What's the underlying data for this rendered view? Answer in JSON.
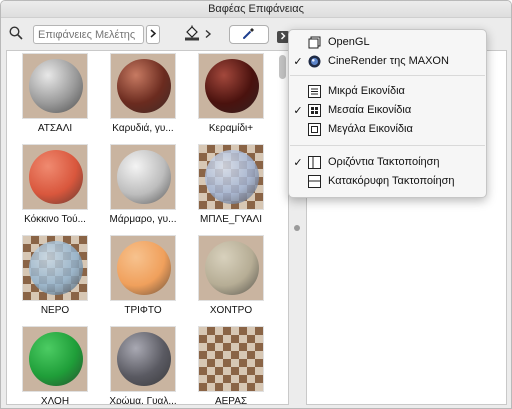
{
  "window": {
    "title": "Βαφέας Επιφάνειας"
  },
  "toolbar": {
    "search_placeholder": "Επιφάνειες Μελέτης",
    "search_icon": "search-icon",
    "filter_icon": "chevron-right-icon",
    "paint_icon": "paint-bucket-icon",
    "dropper_icon": "eyedropper-icon",
    "menu_icon": "chevron-right-icon"
  },
  "surfaces": [
    {
      "label": "ΑΤΣΑΛΙ",
      "color": "#9a9a9a",
      "highlight": "#e8e8e8",
      "checker": false
    },
    {
      "label": "Καρυδιά, γυ...",
      "color": "#6b2b1f",
      "highlight": "#c77a62",
      "checker": false
    },
    {
      "label": "Κεραμίδι+",
      "color": "#4a120e",
      "highlight": "#a3483c",
      "checker": false
    },
    {
      "label": "Κόκκινο Τού...",
      "color": "#d9573d",
      "highlight": "#f08a70",
      "checker": false
    },
    {
      "label": "Μάρμαρο, γυ...",
      "color": "#bdbdbd",
      "highlight": "#f4f4f4",
      "checker": false
    },
    {
      "label": "ΜΠΛΕ_ΓΥΑΛΙ",
      "color": "#9fb3d6",
      "highlight": "#d9e3f3",
      "checker": true
    },
    {
      "label": "ΝΕΡΟ",
      "color": "#8fb2cf",
      "highlight": "#c8dbea",
      "checker": true
    },
    {
      "label": "ΤΡΙΦΤΟ",
      "color": "#f0a05c",
      "highlight": "#f7c28e",
      "checker": false
    },
    {
      "label": "ΧΟΝΤΡΟ",
      "color": "#b6ad95",
      "highlight": "#d8d1bd",
      "checker": false
    },
    {
      "label": "ΧΛΟΗ",
      "color": "#1f9e39",
      "highlight": "#4ccc63",
      "checker": false
    },
    {
      "label": "Χρώμα, Γυαλ...",
      "color": "#5a5a62",
      "highlight": "#a9a9b3",
      "checker": false
    },
    {
      "label": "ΑΕΡΑΣ",
      "color": "#c7b09c",
      "highlight": "#c7b09c",
      "checker": true
    }
  ],
  "menu": {
    "items": [
      {
        "label": "OpenGL",
        "checked": false,
        "icon": "window-square-icon"
      },
      {
        "label": "CineRender της MAXON",
        "checked": true,
        "icon": "maxon-logo-icon"
      },
      {
        "label": "Μικρά Εικονίδια",
        "checked": false,
        "icon": "list-view-icon"
      },
      {
        "label": "Μεσαία Εικονίδια",
        "checked": true,
        "icon": "grid-view-icon"
      },
      {
        "label": "Μεγάλα Εικονίδια",
        "checked": false,
        "icon": "large-icon-view-icon"
      },
      {
        "label": "Οριζόντια Τακτοποίηση",
        "checked": true,
        "icon": "split-vertical-icon"
      },
      {
        "label": "Κατακόρυφη Τακτοποίηση",
        "checked": false,
        "icon": "split-horizontal-icon"
      }
    ]
  }
}
